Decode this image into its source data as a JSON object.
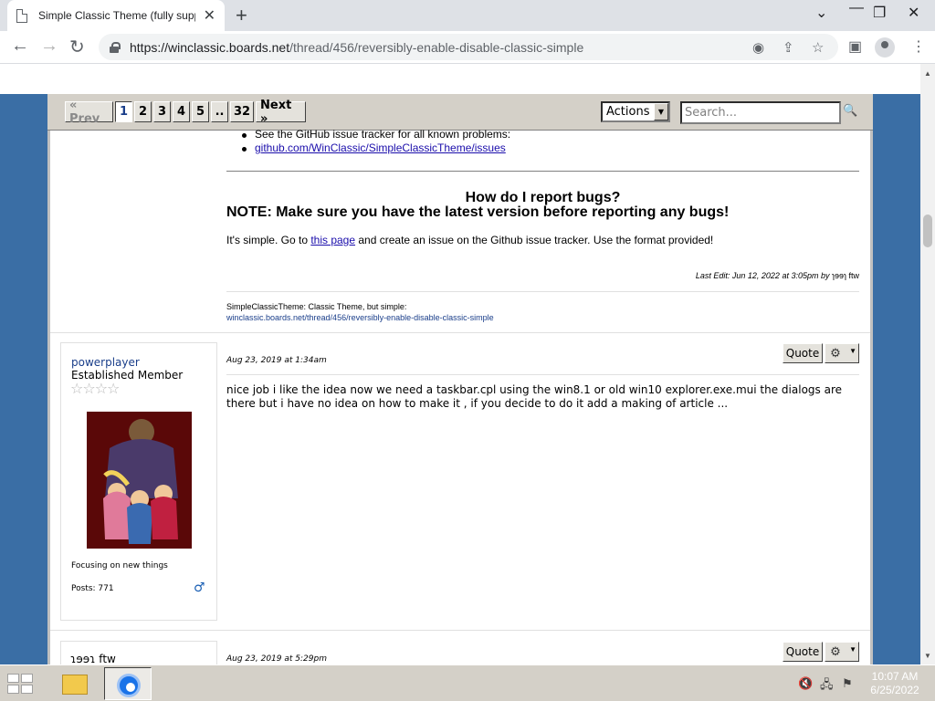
{
  "browser": {
    "tab_title": "Simple Classic Theme (fully supp",
    "url_host": "https://winclassic.boards.net",
    "url_path": "/thread/456/reversibly-enable-disable-classic-simple"
  },
  "pager": {
    "prev": "« Prev",
    "pages": [
      "1",
      "2",
      "3",
      "4",
      "5",
      "..",
      "32"
    ],
    "next": "Next »",
    "actions_label": "Actions",
    "search_placeholder": "Search..."
  },
  "post1": {
    "bullet1": "See the GitHub issue tracker for all known problems:",
    "bullet2_link": "github.com/WinClassic/SimpleClassicTheme/issues",
    "heading": "How do I report bugs?",
    "note": "NOTE: Make sure you have the latest version before reporting any bugs!",
    "para_before": "It's simple. Go to ",
    "para_link": "this page",
    "para_after": " and create an issue on the Github issue tracker. Use the format provided!",
    "last_edit": "Last Edit: Jun 12, 2022 at 3:05pm by ",
    "last_edit_user": "ɿɘɘɿ ftw",
    "signature_line1": "SimpleClassicTheme: Classic Theme, but simple:",
    "signature_line2": "winclassic.boards.net/thread/456/reversibly-enable-disable-classic-simple"
  },
  "post2": {
    "username": "powerplayer",
    "rank": "Established Member",
    "stars": "☆☆☆☆",
    "user_desc": "Focusing on new things",
    "posts": "Posts: 771",
    "gender": "♂",
    "time": "Aug 23, 2019 at 1:34am",
    "quote_label": "Quote",
    "body": "nice job i like the idea now we need a taskbar.cpl using the win8.1 or old win10 explorer.exe.mui the dialogs are there but i have no idea on how to make it , if you decide to do it add a making of article ..."
  },
  "post3": {
    "username": "ɿɘɘɿ ftw",
    "time": "Aug 23, 2019 at 5:29pm",
    "quote_label": "Quote"
  },
  "taskbar": {
    "time": "10:07 AM",
    "date": "6/25/2022"
  }
}
